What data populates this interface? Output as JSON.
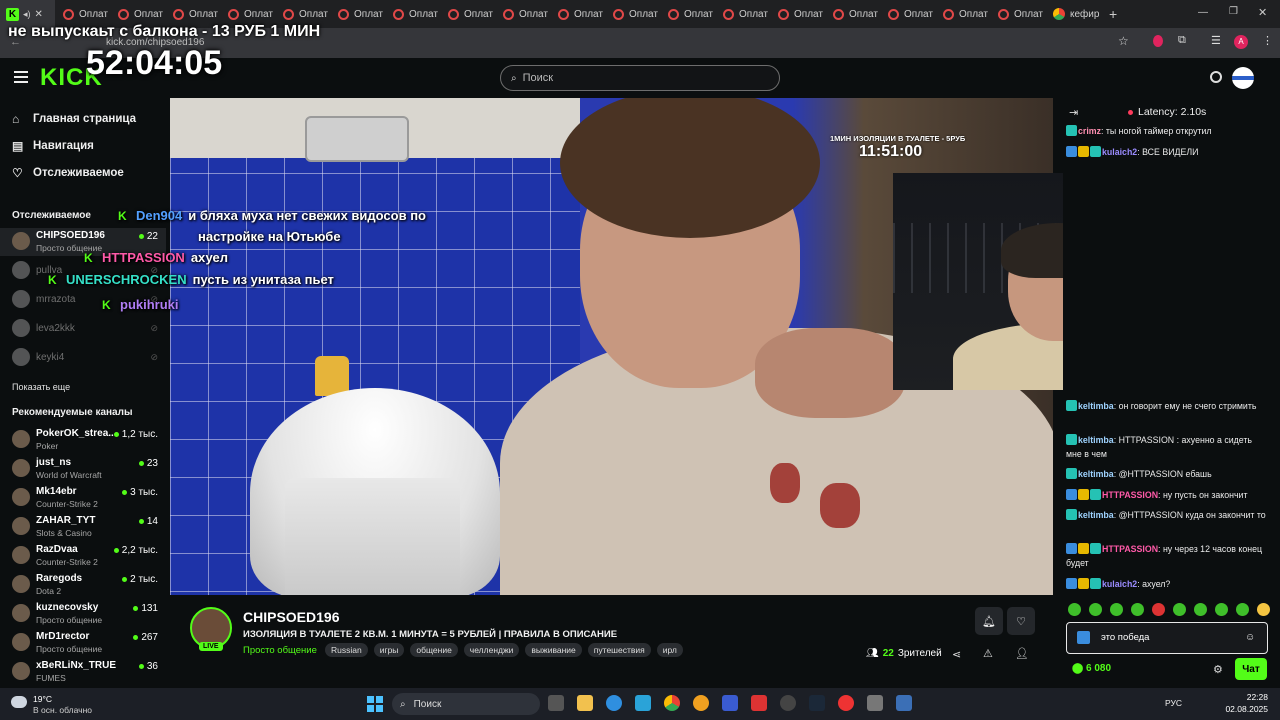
{
  "browser": {
    "tabs": [
      "Оплат",
      "Оплат",
      "Оплат",
      "Оплат",
      "Оплат",
      "Оплат",
      "Оплат",
      "Оплат",
      "Оплат",
      "Оплат",
      "Оплат",
      "Оплат",
      "Оплат",
      "Оплат",
      "Оплат",
      "Оплат",
      "Оплат",
      "Оплат"
    ],
    "last_tab": "кефир",
    "url": "kick.com/chipsoed196"
  },
  "overlay": {
    "title": "не выпускаьт с балкона - 13 РУБ 1 МИН",
    "timer": "52:04:05",
    "isolation_label": "1МИН ИЗОЛЯЦИИ В ТУАЛЕТЕ - 5РУБ",
    "isolation_timer": "11:51:00",
    "chat": [
      {
        "user": "Den904",
        "color": "#53a0ff",
        "text": "и бляха муха нет свежих видосов по"
      },
      {
        "user": "",
        "color": "#ffffff",
        "text": "настройке на Ютьюбе"
      },
      {
        "user": "HTTPASSION",
        "color": "#ff5aa8",
        "text": "ахуел"
      },
      {
        "user": "UNERSCHROCKEN",
        "color": "#35e0c8",
        "text": "пусть из унитаза пьет"
      },
      {
        "user": "pukihruki",
        "color": "#b07ef5",
        "text": ""
      }
    ]
  },
  "header": {
    "logo": "KICK",
    "search_placeholder": "Поиск"
  },
  "sidebar": {
    "nav": [
      {
        "label": "Главная страница"
      },
      {
        "label": "Навигация"
      },
      {
        "label": "Отслеживаемое"
      }
    ],
    "followed_title": "Отслеживаемое",
    "followed": [
      {
        "name": "CHIPSOED196",
        "category": "Просто общение",
        "viewers": "22",
        "online": true
      },
      {
        "name": "pullva",
        "category": "",
        "viewers": "",
        "online": false
      },
      {
        "name": "mrrazota",
        "category": "",
        "viewers": "",
        "online": false
      },
      {
        "name": "leva2kkk",
        "category": "",
        "viewers": "",
        "online": false
      },
      {
        "name": "keyki4",
        "category": "",
        "viewers": "",
        "online": false
      }
    ],
    "show_more": "Показать еще",
    "recommended_title": "Рекомендуемые каналы",
    "recommended": [
      {
        "name": "PokerOK_strea...",
        "category": "Poker",
        "viewers": "1,2 тыс."
      },
      {
        "name": "just_ns",
        "category": "World of Warcraft",
        "viewers": "23"
      },
      {
        "name": "Mk14ebr",
        "category": "Counter-Strike 2",
        "viewers": "3 тыс."
      },
      {
        "name": "ZAHAR_TYT",
        "category": "Slots & Casino",
        "viewers": "14"
      },
      {
        "name": "RazDvaa",
        "category": "Counter-Strike 2",
        "viewers": "2,2 тыс."
      },
      {
        "name": "Raregods",
        "category": "Dota 2",
        "viewers": "2 тыс."
      },
      {
        "name": "kuznecovsky",
        "category": "Просто общение",
        "viewers": "131"
      },
      {
        "name": "MrD1rector",
        "category": "Просто общение",
        "viewers": "267"
      },
      {
        "name": "xBeRLiNx_TRUE",
        "category": "FUMES",
        "viewers": "36"
      }
    ]
  },
  "stream": {
    "live_label": "LIVE",
    "streamer": "CHIPSOED196",
    "title": "ИЗОЛЯЦИЯ В ТУАЛЕТЕ 2 КВ.М. 1 МИНУТА = 5 РУБЛЕЙ | ПРАВИЛА В ОПИСАНИЕ",
    "category": "Просто общение",
    "tags": [
      "Russian",
      "игры",
      "общение",
      "челленджи",
      "выживание",
      "путешествия",
      "ирл"
    ],
    "viewers": "22",
    "viewers_label": "Зрителей"
  },
  "chat": {
    "latency": "Latency: 2.10s",
    "messages_top": [
      {
        "user": "crimz",
        "color": "#ff8fb1",
        "text": "ты ногой таймер открутил",
        "badges": [
          "teal"
        ]
      },
      {
        "user": "kulaich2",
        "color": "#9b8cff",
        "text": "ВСЕ ВИДЕЛИ",
        "badges": [
          "blue",
          "gold",
          "teal"
        ]
      }
    ],
    "messages": [
      {
        "user": "keltimba",
        "color": "#9fd3ff",
        "text": "он говорит ему не счего стримить",
        "badges": [
          "teal"
        ]
      },
      {
        "user": "keltimba",
        "color": "#9fd3ff",
        "text": "HTTPASSION : ахуенно а сидеть мне в чем",
        "badges": [
          "teal"
        ]
      },
      {
        "user": "keltimba",
        "color": "#9fd3ff",
        "text": "@HTTPASSION ебашь",
        "badges": [
          "teal"
        ]
      },
      {
        "user": "HTTPASSION",
        "color": "#ff5aa8",
        "text": "ну пусть он закончит",
        "badges": [
          "blue",
          "gold",
          "teal"
        ]
      },
      {
        "user": "keltimba",
        "color": "#9fd3ff",
        "text": "@HTTPASSION куда он закончит то",
        "badges": [
          "teal"
        ]
      },
      {
        "user": "HTTPASSION",
        "color": "#ff5aa8",
        "text": "ну через 12 часов конец будет",
        "badges": [
          "blue",
          "gold",
          "teal"
        ]
      },
      {
        "user": "kulaich2",
        "color": "#9b8cff",
        "text": "ахуел?",
        "badges": [
          "blue",
          "gold",
          "teal"
        ]
      }
    ],
    "input_value": "это победа",
    "points": "6 080",
    "send_label": "Чат"
  },
  "taskbar": {
    "weather_temp": "19°C",
    "weather_desc": "В осн. облачно",
    "search": "Поиск",
    "lang": "РУС",
    "time": "22:28",
    "date": "02.08.2025"
  }
}
